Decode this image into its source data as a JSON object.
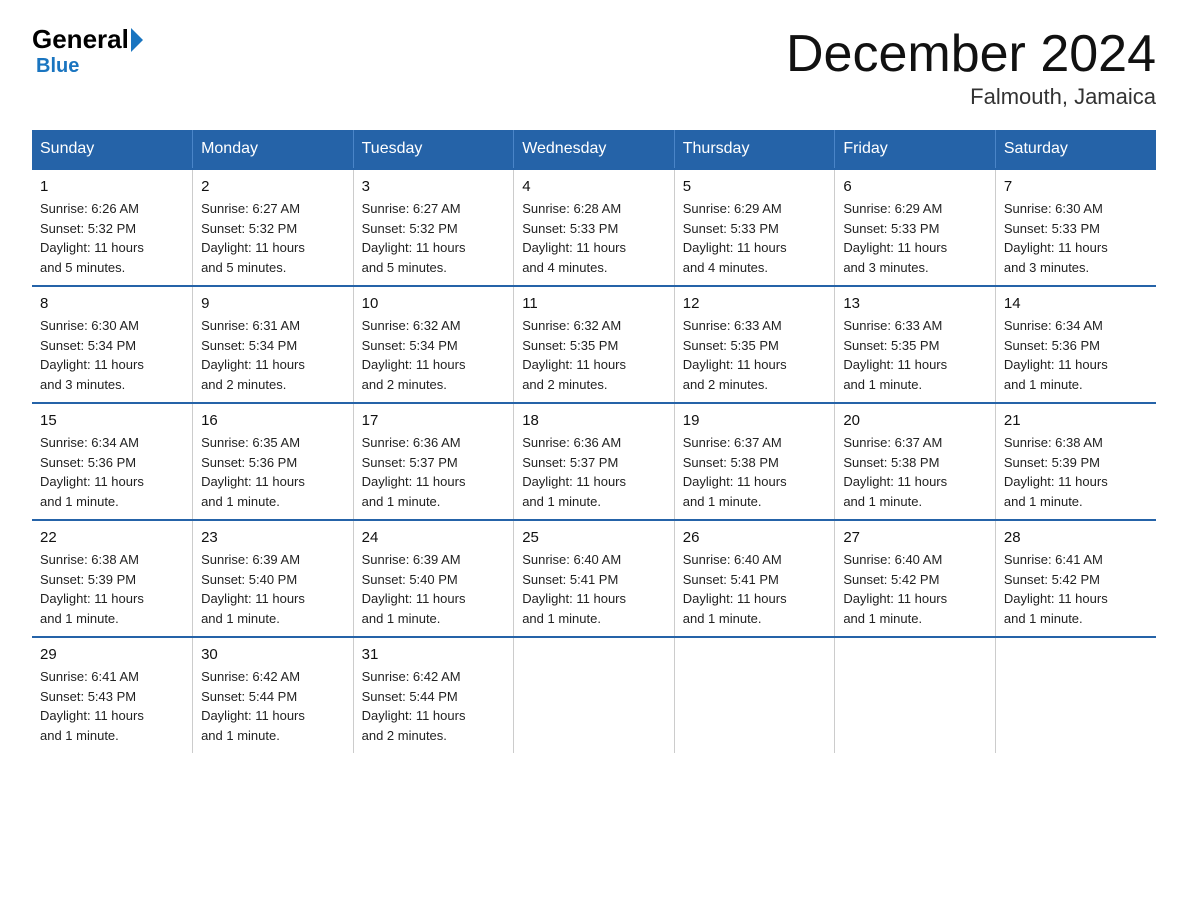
{
  "logo": {
    "general": "General",
    "blue": "Blue"
  },
  "title": "December 2024",
  "location": "Falmouth, Jamaica",
  "days_of_week": [
    "Sunday",
    "Monday",
    "Tuesday",
    "Wednesday",
    "Thursday",
    "Friday",
    "Saturday"
  ],
  "weeks": [
    [
      {
        "day": "1",
        "sunrise": "6:26 AM",
        "sunset": "5:32 PM",
        "daylight": "11 hours and 5 minutes."
      },
      {
        "day": "2",
        "sunrise": "6:27 AM",
        "sunset": "5:32 PM",
        "daylight": "11 hours and 5 minutes."
      },
      {
        "day": "3",
        "sunrise": "6:27 AM",
        "sunset": "5:32 PM",
        "daylight": "11 hours and 5 minutes."
      },
      {
        "day": "4",
        "sunrise": "6:28 AM",
        "sunset": "5:33 PM",
        "daylight": "11 hours and 4 minutes."
      },
      {
        "day": "5",
        "sunrise": "6:29 AM",
        "sunset": "5:33 PM",
        "daylight": "11 hours and 4 minutes."
      },
      {
        "day": "6",
        "sunrise": "6:29 AM",
        "sunset": "5:33 PM",
        "daylight": "11 hours and 3 minutes."
      },
      {
        "day": "7",
        "sunrise": "6:30 AM",
        "sunset": "5:33 PM",
        "daylight": "11 hours and 3 minutes."
      }
    ],
    [
      {
        "day": "8",
        "sunrise": "6:30 AM",
        "sunset": "5:34 PM",
        "daylight": "11 hours and 3 minutes."
      },
      {
        "day": "9",
        "sunrise": "6:31 AM",
        "sunset": "5:34 PM",
        "daylight": "11 hours and 2 minutes."
      },
      {
        "day": "10",
        "sunrise": "6:32 AM",
        "sunset": "5:34 PM",
        "daylight": "11 hours and 2 minutes."
      },
      {
        "day": "11",
        "sunrise": "6:32 AM",
        "sunset": "5:35 PM",
        "daylight": "11 hours and 2 minutes."
      },
      {
        "day": "12",
        "sunrise": "6:33 AM",
        "sunset": "5:35 PM",
        "daylight": "11 hours and 2 minutes."
      },
      {
        "day": "13",
        "sunrise": "6:33 AM",
        "sunset": "5:35 PM",
        "daylight": "11 hours and 1 minute."
      },
      {
        "day": "14",
        "sunrise": "6:34 AM",
        "sunset": "5:36 PM",
        "daylight": "11 hours and 1 minute."
      }
    ],
    [
      {
        "day": "15",
        "sunrise": "6:34 AM",
        "sunset": "5:36 PM",
        "daylight": "11 hours and 1 minute."
      },
      {
        "day": "16",
        "sunrise": "6:35 AM",
        "sunset": "5:36 PM",
        "daylight": "11 hours and 1 minute."
      },
      {
        "day": "17",
        "sunrise": "6:36 AM",
        "sunset": "5:37 PM",
        "daylight": "11 hours and 1 minute."
      },
      {
        "day": "18",
        "sunrise": "6:36 AM",
        "sunset": "5:37 PM",
        "daylight": "11 hours and 1 minute."
      },
      {
        "day": "19",
        "sunrise": "6:37 AM",
        "sunset": "5:38 PM",
        "daylight": "11 hours and 1 minute."
      },
      {
        "day": "20",
        "sunrise": "6:37 AM",
        "sunset": "5:38 PM",
        "daylight": "11 hours and 1 minute."
      },
      {
        "day": "21",
        "sunrise": "6:38 AM",
        "sunset": "5:39 PM",
        "daylight": "11 hours and 1 minute."
      }
    ],
    [
      {
        "day": "22",
        "sunrise": "6:38 AM",
        "sunset": "5:39 PM",
        "daylight": "11 hours and 1 minute."
      },
      {
        "day": "23",
        "sunrise": "6:39 AM",
        "sunset": "5:40 PM",
        "daylight": "11 hours and 1 minute."
      },
      {
        "day": "24",
        "sunrise": "6:39 AM",
        "sunset": "5:40 PM",
        "daylight": "11 hours and 1 minute."
      },
      {
        "day": "25",
        "sunrise": "6:40 AM",
        "sunset": "5:41 PM",
        "daylight": "11 hours and 1 minute."
      },
      {
        "day": "26",
        "sunrise": "6:40 AM",
        "sunset": "5:41 PM",
        "daylight": "11 hours and 1 minute."
      },
      {
        "day": "27",
        "sunrise": "6:40 AM",
        "sunset": "5:42 PM",
        "daylight": "11 hours and 1 minute."
      },
      {
        "day": "28",
        "sunrise": "6:41 AM",
        "sunset": "5:42 PM",
        "daylight": "11 hours and 1 minute."
      }
    ],
    [
      {
        "day": "29",
        "sunrise": "6:41 AM",
        "sunset": "5:43 PM",
        "daylight": "11 hours and 1 minute."
      },
      {
        "day": "30",
        "sunrise": "6:42 AM",
        "sunset": "5:44 PM",
        "daylight": "11 hours and 1 minute."
      },
      {
        "day": "31",
        "sunrise": "6:42 AM",
        "sunset": "5:44 PM",
        "daylight": "11 hours and 2 minutes."
      },
      null,
      null,
      null,
      null
    ]
  ],
  "labels": {
    "sunrise": "Sunrise:",
    "sunset": "Sunset:",
    "daylight": "Daylight:"
  }
}
